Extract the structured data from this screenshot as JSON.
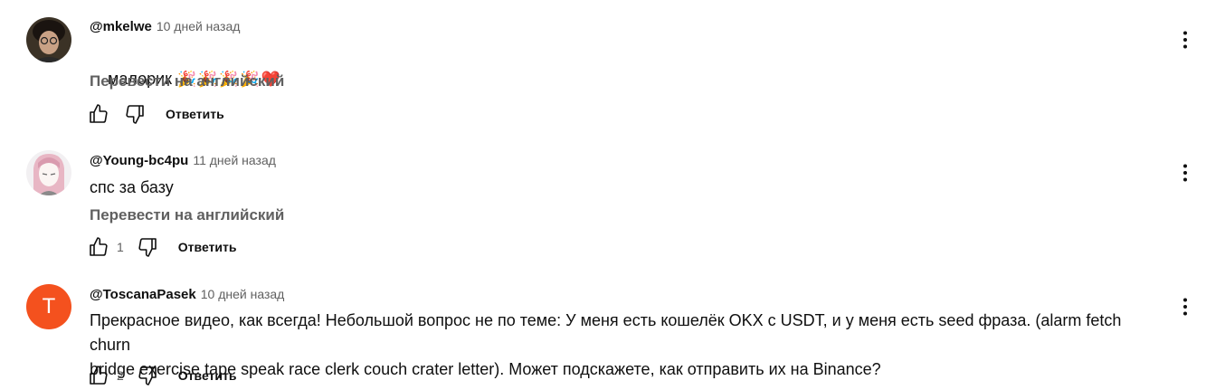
{
  "comments": [
    {
      "author": "@mkelwe",
      "time": "10 дней назад",
      "text": "малорик",
      "emojis": [
        "🎉",
        "🎉",
        "🎉",
        "🎉",
        "❤️"
      ],
      "translate_label": "Перевести на английский",
      "like_count": "",
      "reply_label": "Ответить"
    },
    {
      "author": "@Young-bc4pu",
      "time": "11 дней назад",
      "text": "спс за базу",
      "translate_label": "Перевести на английский",
      "like_count": "1",
      "reply_label": "Ответить"
    },
    {
      "author": "@ToscanaPasek",
      "time": "10 дней назад",
      "avatar_letter": "T",
      "avatar_color": "#f4511e",
      "text": "Прекрасное видео, как всегда! Небольшой вопрос не по теме: У меня есть кошелёк OKX с USDT, и у меня есть seed фраза. (alarm fetch churn\nbridge exercise tape speak race clerk couch crater letter). Может подскажете, как отправить их на Binance?",
      "like_count": "2",
      "reply_label": "Ответить"
    }
  ],
  "icons": {
    "like": "thumb-up-icon",
    "dislike": "thumb-down-icon",
    "menu": "more-vert-icon"
  }
}
